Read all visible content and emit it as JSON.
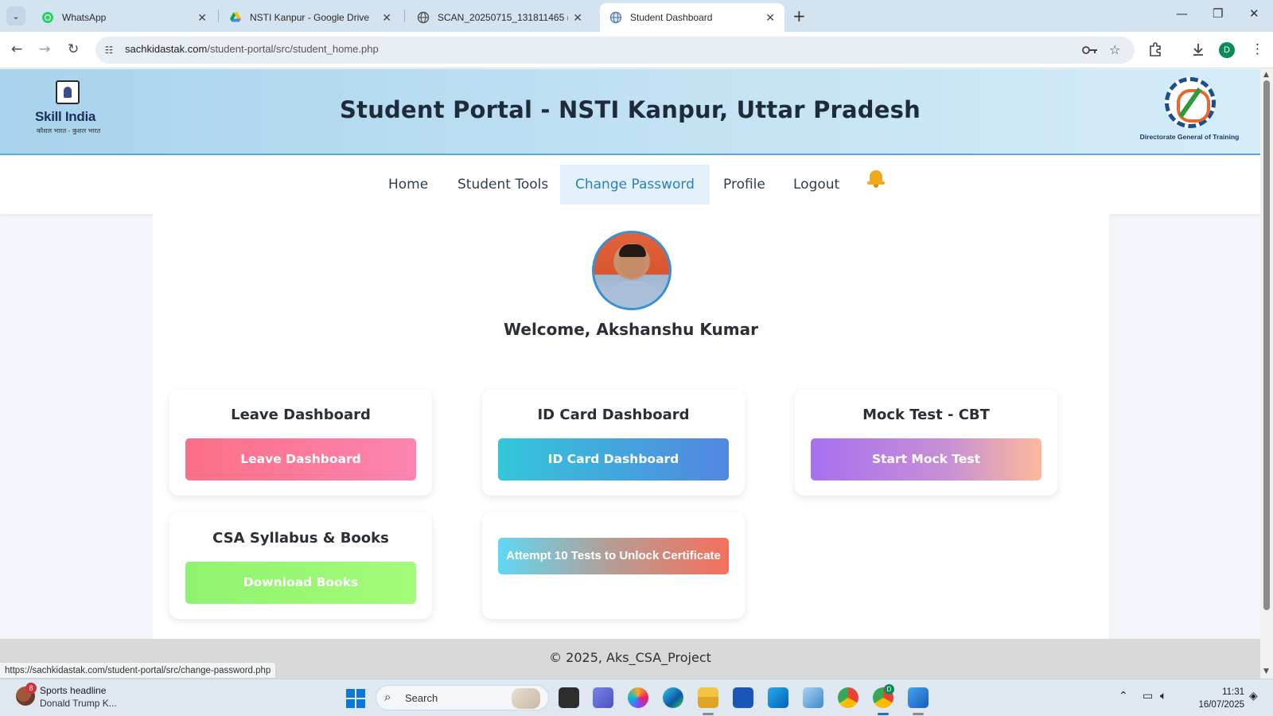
{
  "browser": {
    "tabs": [
      {
        "title": "WhatsApp",
        "icon": "whatsapp-icon"
      },
      {
        "title": "NSTI Kanpur - Google Drive",
        "icon": "google-drive-icon"
      },
      {
        "title": "SCAN_20250715_131811465 (2",
        "icon": "globe-icon"
      },
      {
        "title": "Student Dashboard",
        "icon": "globe-icon",
        "active": true
      }
    ],
    "url_host": "sachkidastak.com",
    "url_path": "/student-portal/src/student_home.php",
    "profile_initial": "D",
    "status_url": "https://sachkidastak.com/student-portal/src/change-password.php"
  },
  "header": {
    "title": "Student Portal - NSTI Kanpur, Uttar Pradesh",
    "left_logo": {
      "wordmark": "Skill India",
      "tagline": "कौशल भारत - कुशल भारत"
    },
    "right_logo": {
      "caption": "Directorate General of Training"
    }
  },
  "nav": {
    "items": [
      {
        "label": "Home"
      },
      {
        "label": "Student Tools"
      },
      {
        "label": "Change Password",
        "active": true
      },
      {
        "label": "Profile"
      },
      {
        "label": "Logout"
      }
    ],
    "bell_icon": "bell-icon"
  },
  "main": {
    "welcome": "Welcome, Akshanshu Kumar",
    "cards": [
      {
        "title": "Leave Dashboard",
        "button": "Leave Dashboard"
      },
      {
        "title": "ID Card Dashboard",
        "button": "ID Card Dashboard"
      },
      {
        "title": "Mock Test - CBT",
        "button": "Start Mock Test"
      },
      {
        "title": "CSA Syllabus & Books",
        "button": "Download Books"
      },
      {
        "title": "",
        "button": "Attempt 10 Tests to Unlock Certificate"
      }
    ]
  },
  "footer": {
    "text": "© 2025, Aks_CSA_Project"
  },
  "taskbar": {
    "news_badge": "8",
    "news_title": "Sports headline",
    "news_sub": "Donald Trump K...",
    "search_label": "Search",
    "profile_badge": "D",
    "time": "11:31",
    "date": "16/07/2025"
  },
  "colors": {
    "accent": "#2a7fc4",
    "leave_btn": [
      "#fb6f86",
      "#fc84b1"
    ],
    "id_btn": [
      "#33c7d9",
      "#5286e0"
    ],
    "mock_btn": [
      "#a770ef",
      "#fdb99b"
    ],
    "books_btn": [
      "#8ff36f",
      "#a4fb79"
    ]
  }
}
